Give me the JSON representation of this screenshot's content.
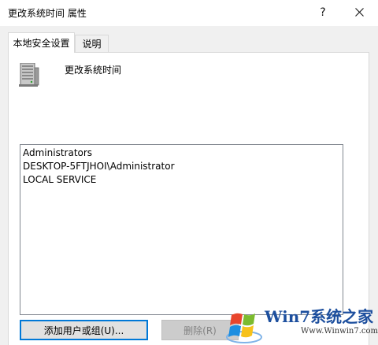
{
  "window": {
    "title": "更改系统时间 属性",
    "help_glyph": "?",
    "close_glyph": "✕"
  },
  "tabs": [
    {
      "label": "本地安全设置",
      "active": true
    },
    {
      "label": "说明",
      "active": false
    }
  ],
  "policy": {
    "icon": "server-computer-icon",
    "name": "更改系统时间"
  },
  "accounts": [
    "Administrators",
    "DESKTOP-5FTJHOI\\Administrator",
    "LOCAL SERVICE"
  ],
  "buttons": {
    "add_label": "添加用户或组(U)...",
    "remove_label": "删除(R)"
  },
  "watermark": {
    "brand": "Win7系统之家",
    "url": "Www.Winwin7.com"
  },
  "colors": {
    "accent": "#0078d7",
    "list_border": "#828790"
  }
}
